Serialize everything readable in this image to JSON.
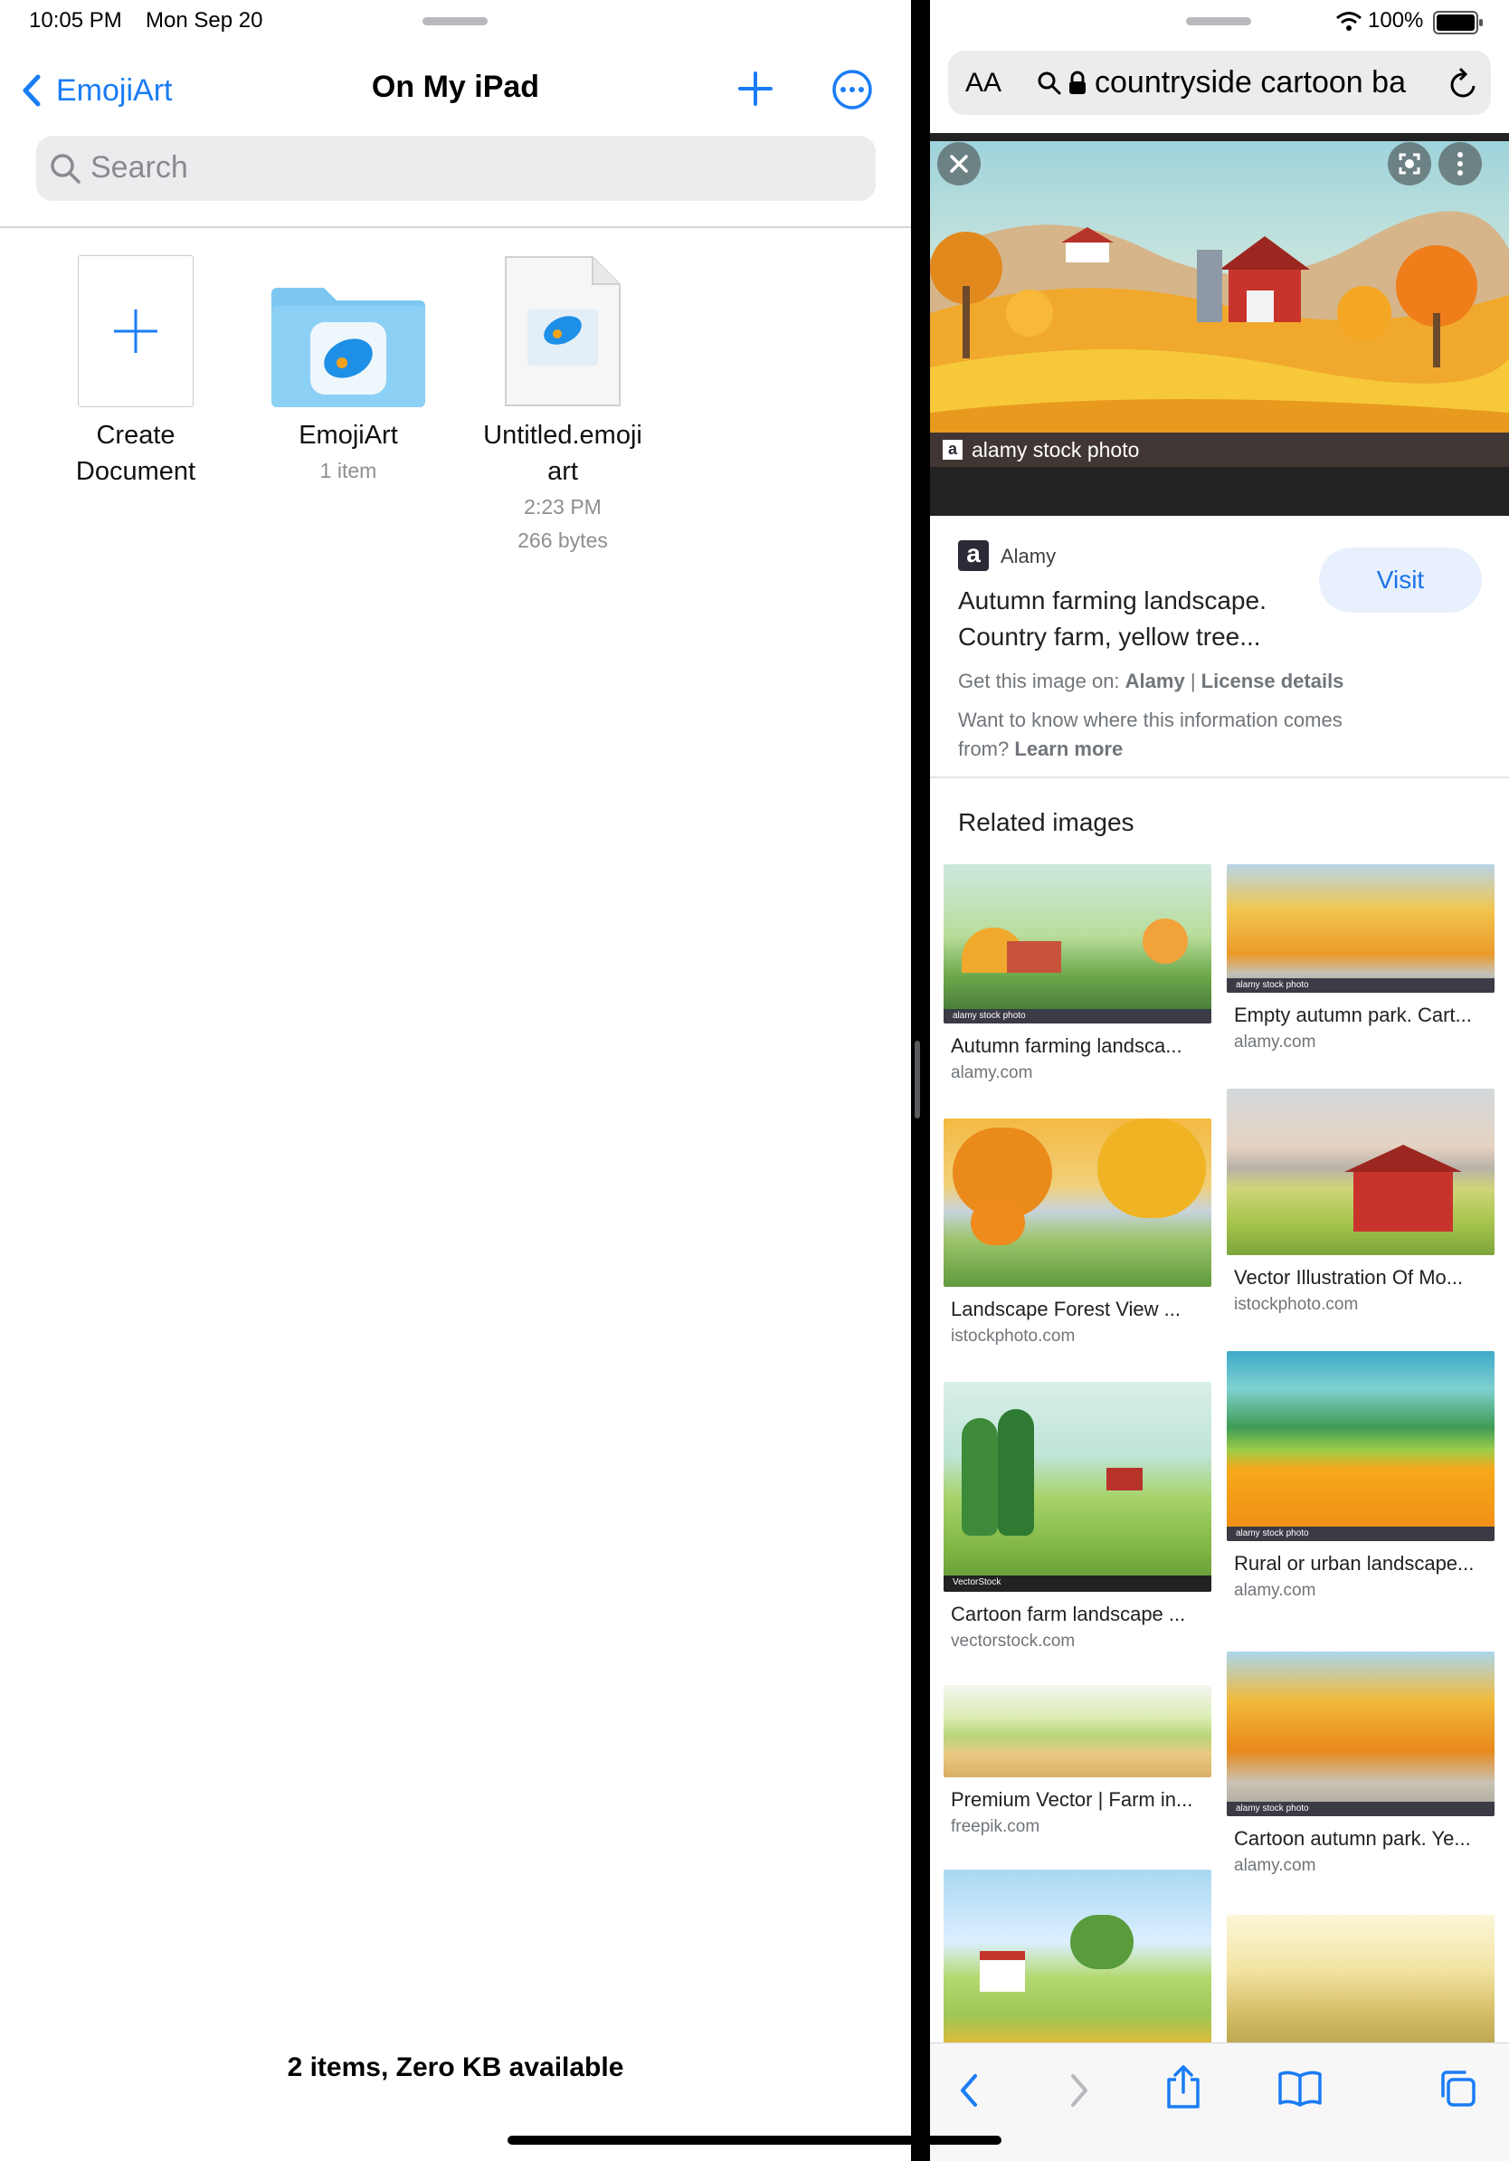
{
  "status": {
    "time": "10:05 PM",
    "date": "Mon Sep 20",
    "battery": "100%"
  },
  "files": {
    "back_label": "EmojiArt",
    "title": "On My iPad",
    "search_placeholder": "Search",
    "items": [
      {
        "label_line1": "Create",
        "label_line2": "Document"
      },
      {
        "label": "EmojiArt",
        "sub": "1 item"
      },
      {
        "label_line1": "Untitled.emoji",
        "label_line2": "art",
        "time": "2:23 PM",
        "size": "266 bytes"
      }
    ],
    "footer": "2 items, Zero KB available"
  },
  "browser": {
    "aa_label": "AA",
    "url_text": "countryside cartoon ba",
    "hero_watermark": "alamy stock photo",
    "source_name": "Alamy",
    "result_title_line1": "Autumn farming landscape.",
    "result_title_line2": "Country farm, yellow tree...",
    "visit_label": "Visit",
    "get_image_prefix": "Get this image on:",
    "get_image_source": "Alamy",
    "license_label": "License details",
    "info_text_line1": "Want to know where this information comes",
    "info_text_prefix": "from?",
    "learn_more": "Learn more",
    "related_heading": "Related images",
    "related": [
      {
        "title": "Autumn farming landsca...",
        "source": "alamy.com",
        "wm": "alamy stock photo"
      },
      {
        "title": "Empty autumn park. Cart...",
        "source": "alamy.com",
        "wm": "alamy stock photo"
      },
      {
        "title": "Landscape Forest View ...",
        "source": "istockphoto.com"
      },
      {
        "title": "Vector Illustration Of Mo...",
        "source": "istockphoto.com"
      },
      {
        "title": "Cartoon farm landscape ...",
        "source": "vectorstock.com",
        "wm": "VectorStock"
      },
      {
        "title": "Rural or urban landscape...",
        "source": "alamy.com",
        "wm": "alamy stock photo"
      },
      {
        "title": "Premium Vector | Farm in...",
        "source": "freepik.com"
      },
      {
        "title": "Cartoon autumn park. Ye...",
        "source": "alamy.com",
        "wm": "alamy stock photo"
      }
    ]
  },
  "colors": {
    "accent": "#1a7cf5",
    "folder": "#7cc7f2",
    "visit_bg": "#e8f0fe",
    "visit_text": "#1a73e8"
  }
}
